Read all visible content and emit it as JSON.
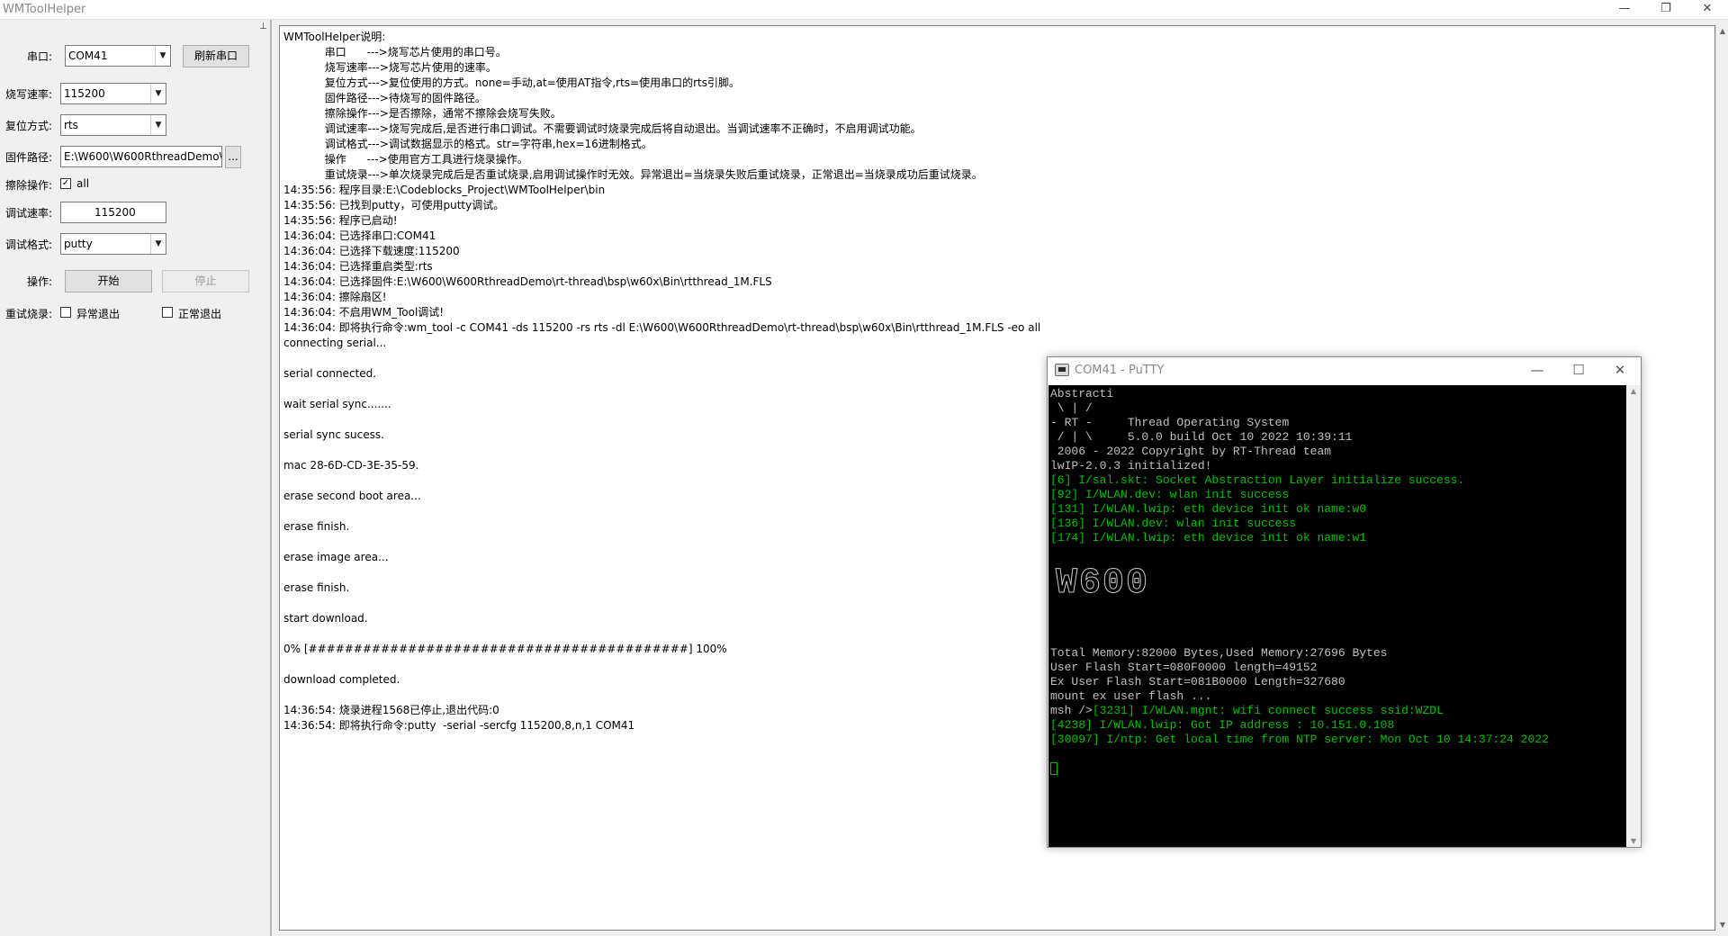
{
  "window": {
    "title": "WMToolHelper",
    "min": "—",
    "restore": "❐",
    "close": "✕"
  },
  "leftpanel": {
    "pin": "⊥",
    "port_label": "串口:",
    "port_value": "COM41",
    "refresh_label": "刷新串口",
    "baud_label": "烧写速率:",
    "baud_value": "115200",
    "reset_label": "复位方式:",
    "reset_value": "rts",
    "firmware_label": "固件路径:",
    "firmware_value": "E:\\W600\\W600RthreadDemo\\",
    "browse_label": "...",
    "erase_label": "擦除操作:",
    "erase_checked": "✓",
    "erase_option": "all",
    "debug_baud_label": "调试速率:",
    "debug_baud_value": "115200",
    "debug_format_label": "调试格式:",
    "debug_format_value": "putty",
    "op_label": "操作:",
    "start_label": "开始",
    "stop_label": "停止",
    "retry_label": "重试烧录:",
    "retry_abnormal": "异常退出",
    "retry_normal": "正常退出"
  },
  "log": {
    "lines": [
      "WMToolHelper说明:",
      "            串口      --->烧写芯片使用的串口号。",
      "            烧写速率--->烧写芯片使用的速率。",
      "            复位方式--->复位使用的方式。none=手动,at=使用AT指令,rts=使用串口的rts引脚。",
      "            固件路径--->待烧写的固件路径。",
      "            擦除操作--->是否擦除，通常不擦除会烧写失败。",
      "            调试速率--->烧写完成后,是否进行串口调试。不需要调试时烧录完成后将自动退出。当调试速率不正确时，不启用调试功能。",
      "            调试格式--->调试数据显示的格式。str=字符串,hex=16进制格式。",
      "            操作      --->使用官方工具进行烧录操作。",
      "            重试烧录--->单次烧录完成后是否重试烧录,启用调试操作时无效。异常退出=当烧录失败后重试烧录，正常退出=当烧录成功后重试烧录。",
      "14:35:56: 程序目录:E:\\Codeblocks_Project\\WMToolHelper\\bin",
      "14:35:56: 已找到putty，可使用putty调试。",
      "14:35:56: 程序已启动!",
      "14:36:04: 已选择串口:COM41",
      "14:36:04: 已选择下载速度:115200",
      "14:36:04: 已选择重启类型:rts",
      "14:36:04: 已选择固件:E:\\W600\\W600RthreadDemo\\rt-thread\\bsp\\w60x\\Bin\\rtthread_1M.FLS",
      "14:36:04: 擦除扇区!",
      "14:36:04: 不启用WM_Tool调试!",
      "14:36:04: 即将执行命令:wm_tool -c COM41 -ds 115200 -rs rts -dl E:\\W600\\W600RthreadDemo\\rt-thread\\bsp\\w60x\\Bin\\rtthread_1M.FLS -eo all",
      "connecting serial...",
      "",
      "serial connected.",
      "",
      "wait serial sync.......",
      "",
      "serial sync sucess.",
      "",
      "mac 28-6D-CD-3E-35-59.",
      "",
      "erase second boot area...",
      "",
      "erase finish.",
      "",
      "erase image area...",
      "",
      "erase finish.",
      "",
      "start download.",
      "",
      "0% [##########################################] 100%",
      "",
      "download completed.",
      "",
      "14:36:54: 烧录进程1568已停止,退出代码:0",
      "14:36:54: 即将执行命令:putty  -serial -sercfg 115200,8,n,1 COM41"
    ]
  },
  "putty": {
    "title": "COM41 - PuTTY",
    "min": "—",
    "max": "☐",
    "close": "✕",
    "lines": [
      {
        "text": "Abstracti",
        "green": false
      },
      {
        "text": " \\ | /",
        "green": false
      },
      {
        "text": "- RT -     Thread Operating System",
        "green": false
      },
      {
        "text": " / | \\     5.0.0 build Oct 10 2022 10:39:11",
        "green": false
      },
      {
        "text": " 2006 - 2022 Copyright by RT-Thread team",
        "green": false
      },
      {
        "text": "lwIP-2.0.3 initialized!",
        "green": false
      },
      {
        "text": "[6] I/sal.skt: Socket Abstraction Layer initialize success.",
        "green": true
      },
      {
        "text": "[92] I/WLAN.dev: wlan init success",
        "green": true
      },
      {
        "text": "[131] I/WLAN.lwip: eth device init ok name:w0",
        "green": true
      },
      {
        "text": "[136] I/WLAN.dev: wlan init success",
        "green": true
      },
      {
        "text": "[174] I/WLAN.lwip: eth device init ok name:w1",
        "green": true
      }
    ],
    "logo_text": "W600",
    "lines2": [
      {
        "text": "Total Memory:82000 Bytes,Used Memory:27696 Bytes",
        "green": false
      },
      {
        "text": "User Flash Start=080F0000 length=49152",
        "green": false
      },
      {
        "text": "Ex User Flash Start=081B0000 Length=327680",
        "green": false
      },
      {
        "text": "mount ex user flash ...",
        "green": false
      }
    ],
    "prompt": "msh />",
    "prompt_tail": "[3231] I/WLAN.mgnt: wifi connect success ssid:WZDL",
    "lines3": [
      {
        "text": "[4238] I/WLAN.lwip: Got IP address : 10.151.0.108",
        "green": true
      },
      {
        "text": "[30097] I/ntp: Get local time from NTP server: Mon Oct 10 14:37:24 2022",
        "green": true
      }
    ]
  }
}
